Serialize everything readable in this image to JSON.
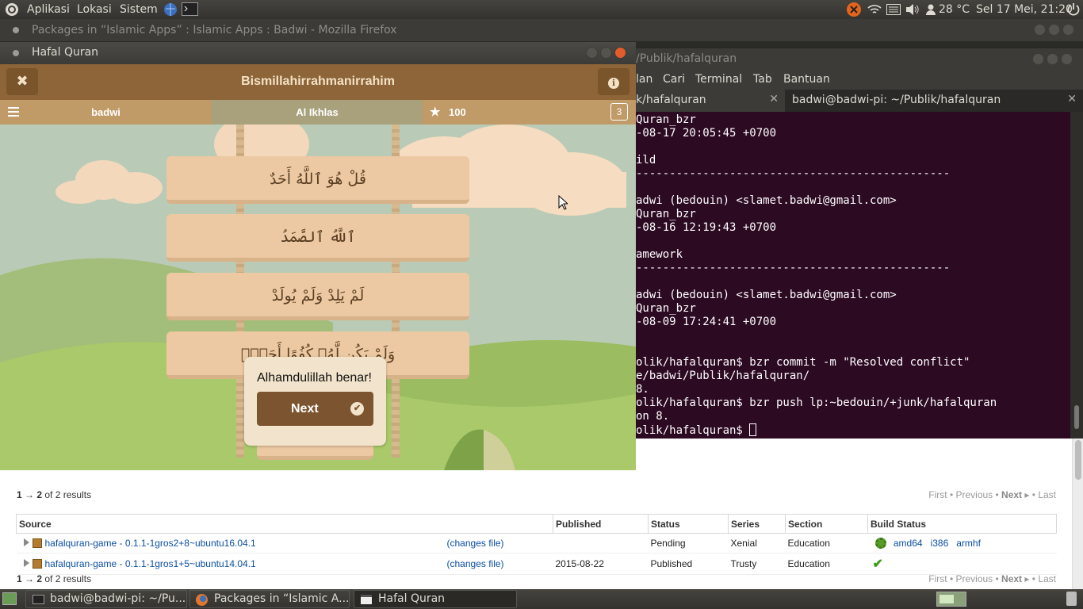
{
  "topbar": {
    "menus": [
      "Aplikasi",
      "Lokasi",
      "Sistem"
    ],
    "temperature": "28 °C",
    "clock": "Sel 17 Mei, 21:20"
  },
  "firefox": {
    "title": "Packages in “Islamic Apps” : Islamic Apps : Badwi - Mozilla Firefox"
  },
  "terminal": {
    "title": "/Publik/hafalquran",
    "menu": [
      "lan",
      "Cari",
      "Terminal",
      "Tab",
      "Bantuan"
    ],
    "tabs": [
      "k/hafalquran",
      "badwi@badwi-pi: ~/Publik/hafalquran"
    ],
    "lines": [
      "Quran_bzr",
      "-08-17 20:05:45 +0700",
      "",
      "ild",
      "-----------------------------------------------",
      "",
      "adwi (bedouin) <slamet.badwi@gmail.com>",
      "Quran_bzr",
      "-08-16 12:19:43 +0700",
      "",
      "amework",
      "-----------------------------------------------",
      "",
      "adwi (bedouin) <slamet.badwi@gmail.com>",
      "Quran_bzr",
      "-08-09 17:24:41 +0700",
      "",
      "",
      "olik/hafalquran$ bzr commit -m \"Resolved conflict\"",
      "e/badwi/Publik/hafalquran/",
      "8.",
      "olik/hafalquran$ bzr push lp:~bedouin/+junk/hafalquran",
      "on 8.",
      "olik/hafalquran$ "
    ]
  },
  "game": {
    "window_title": "Hafal Quran",
    "header_title": "Bismillahirrahmanirrahim",
    "close_glyph": "✖",
    "info_glyph": "ℹ",
    "user": "badwi",
    "surah": "Al Ikhlas",
    "score": "100",
    "level": "3",
    "verses": [
      "قُلْ هُوَ ٱللَّهُ أَحَدٌ",
      "ٱللَّهُ ٱلصَّمَدُ",
      "لَمْ يَلِدْ وَلَمْ يُولَدْ",
      "وَلَمْ يَكُن لَّهُۥ كُفُوًا أَحَدٌۢ"
    ],
    "popup_message": "Alhamdulillah benar!",
    "next_label": "Next"
  },
  "launchpad": {
    "results_top": {
      "from": "1",
      "to": "2",
      "suffix": " of 2 results"
    },
    "results_bottom": {
      "from": "1",
      "to": "2",
      "suffix": " of 2 results"
    },
    "pager": {
      "first": "First",
      "previous": "Previous",
      "next": "Next",
      "last": "Last"
    },
    "columns": [
      "Source",
      "",
      "Published",
      "Status",
      "Series",
      "Section",
      "Build Status"
    ],
    "rows": [
      {
        "source": "hafalquran-game - 0.1.1-1gros2+8~ubuntu16.04.1",
        "changes": "(changes file)",
        "published": "",
        "status": "Pending",
        "series": "Xenial",
        "section": "Education",
        "builds": [
          "amd64",
          "i386",
          "armhf"
        ]
      },
      {
        "source": "hafalquran-game - 0.1.1-1gros1+5~ubuntu14.04.1",
        "changes": "(changes file)",
        "published": "2015-08-22",
        "status": "Published",
        "series": "Trusty",
        "section": "Education",
        "builds": []
      }
    ]
  },
  "taskbar": {
    "tasks": [
      "badwi@badwi-pi: ~/Pu...",
      "Packages in “Islamic A...",
      "Hafal Quran"
    ]
  }
}
